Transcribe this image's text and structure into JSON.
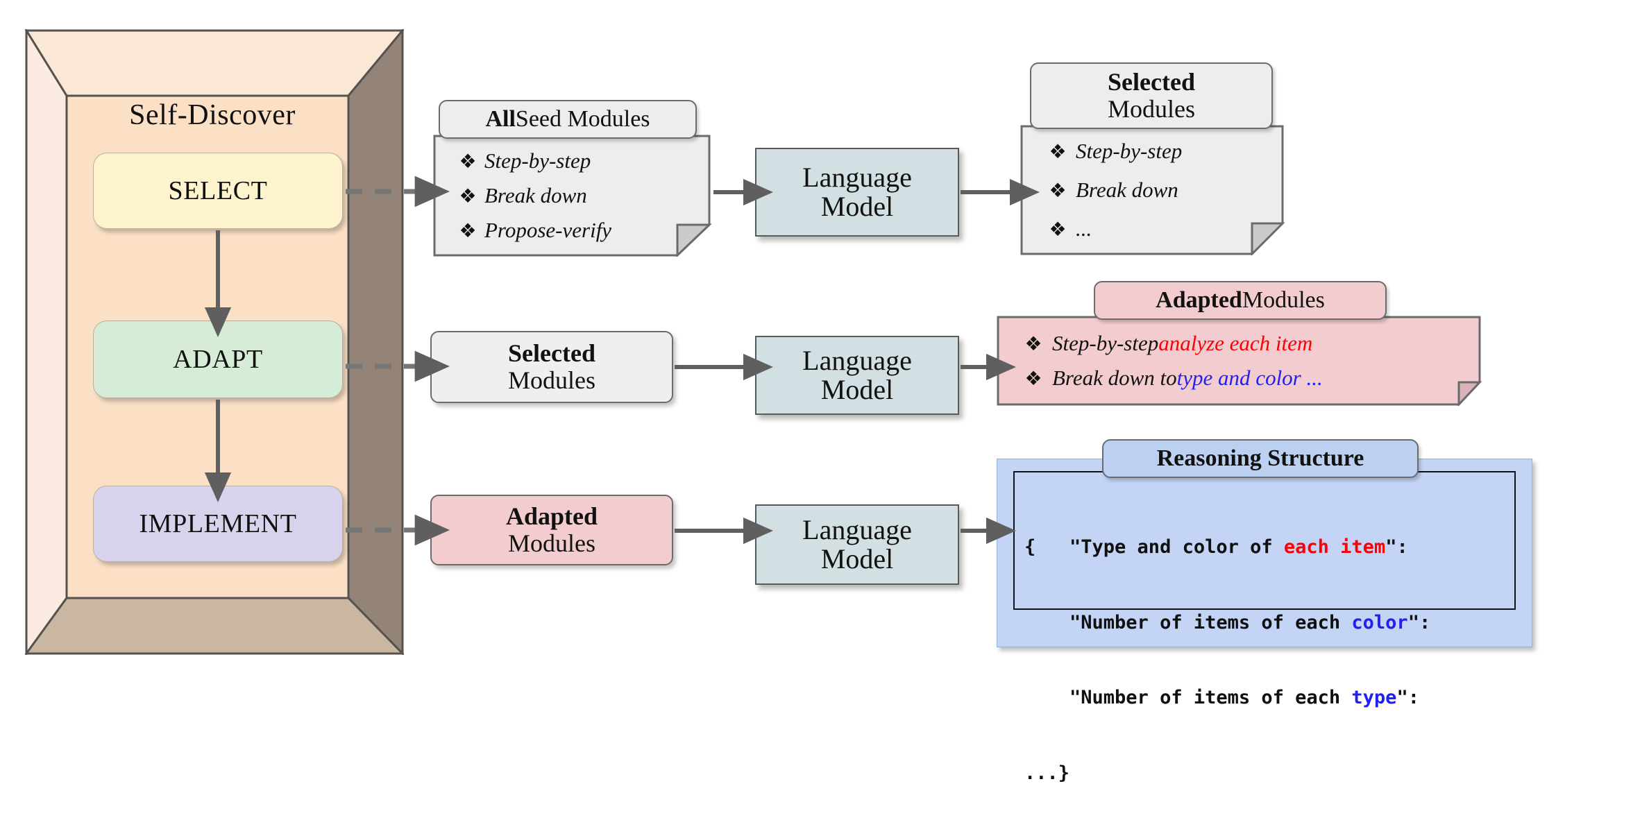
{
  "framework": {
    "title": "Self-Discover",
    "stages": [
      {
        "id": "select",
        "label": "SELECT",
        "color": "#fdf3cd"
      },
      {
        "id": "adapt",
        "label": "ADAPT",
        "color": "#d7ecd7"
      },
      {
        "id": "implement",
        "label": "IMPLEMENT",
        "color": "#d9d2ec"
      }
    ]
  },
  "language_model": {
    "line1": "Language",
    "line2": "Model"
  },
  "flow": {
    "row1": {
      "input_note": {
        "header_bold": "All",
        "header_rest": " Seed Modules",
        "bullet": "❖",
        "items": [
          "Step-by-step",
          "Break down",
          "Propose-verify"
        ]
      },
      "output_note": {
        "header_bold": "Selected",
        "header_rest": "Modules",
        "bullet": "❖",
        "items": [
          "Step-by-step",
          "Break down",
          "..."
        ]
      }
    },
    "row2": {
      "input_pill": {
        "bold": "Selected",
        "rest": "Modules"
      },
      "output_note": {
        "header_bold": "Adapted",
        "header_rest": " Modules",
        "bullet": "❖",
        "items": [
          {
            "plain": "Step-by-step ",
            "red": "analyze each item",
            "blue": ""
          },
          {
            "plain": "Break down to ",
            "red": "",
            "blue": "type and color ..."
          }
        ]
      }
    },
    "row3": {
      "input_pill": {
        "bold": "Adapted",
        "rest": "Modules"
      },
      "output_structure": {
        "header": "Reasoning Structure",
        "code_lines": [
          {
            "prefix": "{   \"Type and color of ",
            "accent": "each item",
            "accent_color": "red",
            "suffix": "\":"
          },
          {
            "prefix": "    \"Number of items of each ",
            "accent": "color",
            "accent_color": "blue",
            "suffix": "\":"
          },
          {
            "prefix": "    \"Number of items of each ",
            "accent": "type",
            "accent_color": "blue",
            "suffix": "\":"
          },
          {
            "prefix": "...}",
            "accent": "",
            "accent_color": "",
            "suffix": ""
          }
        ]
      }
    }
  },
  "colors": {
    "box_top_face": "#fae7d5",
    "box_left_face": "#fcebe0",
    "box_right_face": "#938477",
    "box_bottom_face": "#c9b7a2",
    "box_interior": "#fbe0c6",
    "lm_fill": "#d2e0e3",
    "note_gray": "#ededed",
    "note_pink": "#f3ccd0",
    "reason_blue": "#c3d4f5",
    "reason_header_blue": "#bcd0f2",
    "accent_red": "#fb0007",
    "accent_blue": "#2020f0",
    "connector_gray": "#5f5f5f"
  }
}
